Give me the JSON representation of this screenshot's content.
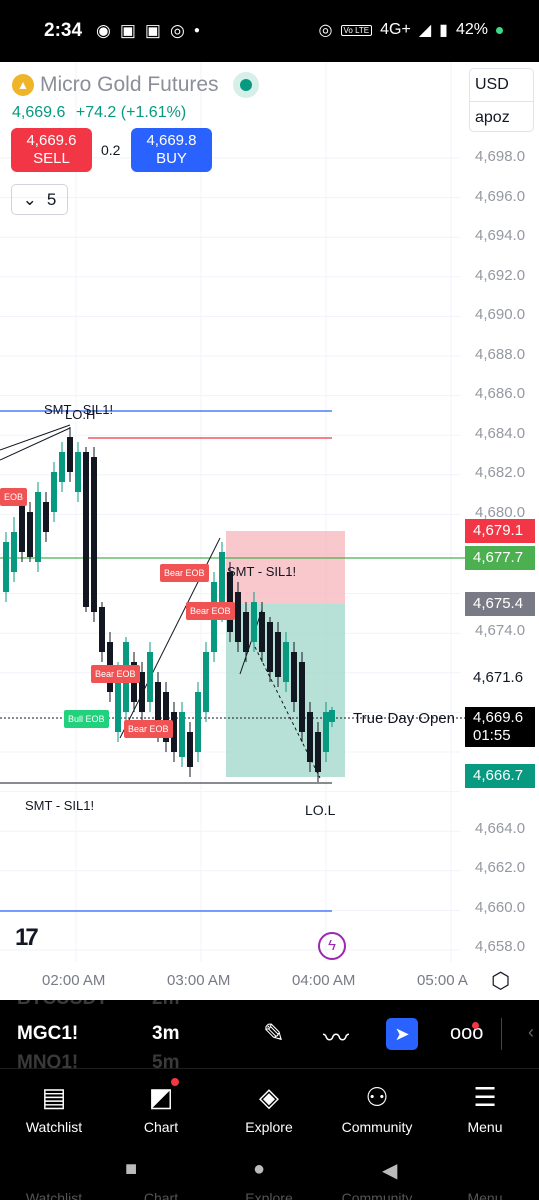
{
  "status_bar": {
    "time": "2:34",
    "left_icons": [
      "messenger-icon",
      "gamepad-icon",
      "gamepad-icon",
      "whatsapp-icon",
      "dot-icon"
    ],
    "network": "4G+",
    "volte": "Vo LTE",
    "battery": "42%"
  },
  "symbol": {
    "name": "Micro Gold Futures",
    "last_price": "4,669.6",
    "change": "+74.2 (+1.61%)",
    "status_color": "#089981"
  },
  "trade": {
    "sell_price": "4,669.6",
    "sell_label": "SELL",
    "spread": "0.2",
    "buy_price": "4,669.8",
    "buy_label": "BUY"
  },
  "interval": {
    "value": "5"
  },
  "currency": {
    "currency": "USD",
    "user": "apoz"
  },
  "price_axis": {
    "labels": [
      "4,698.0",
      "4,696.0",
      "4,694.0",
      "4,692.0",
      "4,690.0",
      "4,688.0",
      "4,686.0",
      "4,684.0",
      "4,682.0",
      "4,680.0",
      "4,674.0",
      "4,664.0",
      "4,662.0",
      "4,660.0",
      "4,658.0"
    ]
  },
  "time_axis": {
    "labels": [
      "02:00 AM",
      "03:00 AM",
      "04:00 AM",
      "05:00 A"
    ]
  },
  "price_tags": {
    "red": "4,679.1",
    "green": "4,677.7",
    "gray": "4,675.4",
    "white": "4,671.6",
    "current": "4,669.6",
    "countdown": "01:55",
    "teal": "4,666.7"
  },
  "annotations": {
    "smt_top": "SMT - SIL1!",
    "loh": "LO.H",
    "smt_mid": "SMT - SIL1!",
    "smt_bottom": "SMT - SIL1!",
    "lol": "LO.L",
    "true_day_open": "True Day Open",
    "bear_eob": "Bear EOB",
    "bull_eob": "Bull EOB",
    "eob_short": "EOB"
  },
  "colors": {
    "bull": "#089981",
    "bear": "#131722",
    "blue_line": "#2962ff",
    "red_line": "#f23645",
    "green_line": "#4caf50"
  },
  "toolbar": {
    "symbols": [
      "BTCUSDT",
      "MGC1!",
      "MNQ1!"
    ],
    "intervals": [
      "2m",
      "3m",
      "5m"
    ],
    "active_symbol": "MGC1!",
    "active_interval": "3m",
    "tools": [
      "pencil-icon",
      "line-tool-icon",
      "favorites-tool-icon",
      "more-icon"
    ]
  },
  "bottom_nav": {
    "watchlist": "Watchlist",
    "chart": "Chart",
    "explore": "Explore",
    "community": "Community",
    "menu": "Menu"
  }
}
